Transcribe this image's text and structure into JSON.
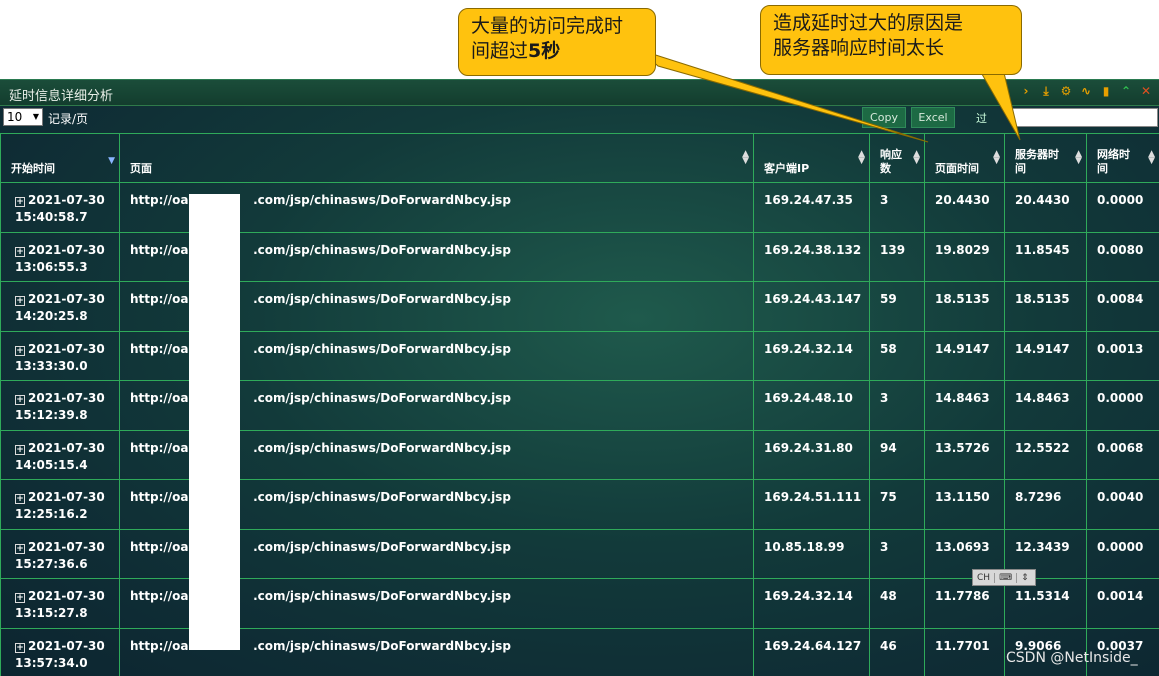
{
  "callouts": {
    "c1_line1": "大量的访问完成时",
    "c1_line2a": "间超过",
    "c1_line2b": "5秒",
    "c2_line1": "造成延时过大的原因是",
    "c2_line2": "服务器响应时间太长"
  },
  "panel": {
    "title": "延时信息详细分析",
    "icons": [
      "chevron-right-icon",
      "download-icon",
      "gear-icon",
      "line-chart-icon",
      "bar-chart-icon",
      "collapse-icon",
      "close-icon"
    ]
  },
  "toolbar": {
    "page_size": "10",
    "records_label": "记录/页",
    "copy_label": "Copy",
    "excel_label": "Excel",
    "search_label": "过"
  },
  "table": {
    "headers": [
      "开始时间",
      "页面",
      "客户端IP",
      "响应数",
      "页面时间",
      "服务器时间",
      "网络时间"
    ],
    "rows": [
      {
        "date": "2021-07-30",
        "time": "15:40:58.7",
        "page_prefix": "http://oa.",
        "page_suffix": ".com/jsp/chinasws/DoForwardNbcy.jsp",
        "ip": "169.24.47.35",
        "responses": "3",
        "page_time": "20.4430",
        "server_time": "20.4430",
        "network_time": "0.0000"
      },
      {
        "date": "2021-07-30",
        "time": "13:06:55.3",
        "page_prefix": "http://oa.",
        "page_suffix": ".com/jsp/chinasws/DoForwardNbcy.jsp",
        "ip": "169.24.38.132",
        "responses": "139",
        "page_time": "19.8029",
        "server_time": "11.8545",
        "network_time": "0.0080"
      },
      {
        "date": "2021-07-30",
        "time": "14:20:25.8",
        "page_prefix": "http://oa.",
        "page_suffix": ".com/jsp/chinasws/DoForwardNbcy.jsp",
        "ip": "169.24.43.147",
        "responses": "59",
        "page_time": "18.5135",
        "server_time": "18.5135",
        "network_time": "0.0084"
      },
      {
        "date": "2021-07-30",
        "time": "13:33:30.0",
        "page_prefix": "http://oa.",
        "page_suffix": ".com/jsp/chinasws/DoForwardNbcy.jsp",
        "ip": "169.24.32.14",
        "responses": "58",
        "page_time": "14.9147",
        "server_time": "14.9147",
        "network_time": "0.0013"
      },
      {
        "date": "2021-07-30",
        "time": "15:12:39.8",
        "page_prefix": "http://oa.",
        "page_suffix": ".com/jsp/chinasws/DoForwardNbcy.jsp",
        "ip": "169.24.48.10",
        "responses": "3",
        "page_time": "14.8463",
        "server_time": "14.8463",
        "network_time": "0.0000"
      },
      {
        "date": "2021-07-30",
        "time": "14:05:15.4",
        "page_prefix": "http://oa.",
        "page_suffix": ".com/jsp/chinasws/DoForwardNbcy.jsp",
        "ip": "169.24.31.80",
        "responses": "94",
        "page_time": "13.5726",
        "server_time": "12.5522",
        "network_time": "0.0068"
      },
      {
        "date": "2021-07-30",
        "time": "12:25:16.2",
        "page_prefix": "http://oa.",
        "page_suffix": ".com/jsp/chinasws/DoForwardNbcy.jsp",
        "ip": "169.24.51.111",
        "responses": "75",
        "page_time": "13.1150",
        "server_time": "8.7296",
        "network_time": "0.0040"
      },
      {
        "date": "2021-07-30",
        "time": "15:27:36.6",
        "page_prefix": "http://oa.",
        "page_suffix": ".com/jsp/chinasws/DoForwardNbcy.jsp",
        "ip": "10.85.18.99",
        "responses": "3",
        "page_time": "13.0693",
        "server_time": "12.3439",
        "network_time": "0.0000"
      },
      {
        "date": "2021-07-30",
        "time": "13:15:27.8",
        "page_prefix": "http://oa.",
        "page_suffix": ".com/jsp/chinasws/DoForwardNbcy.jsp",
        "ip": "169.24.32.14",
        "responses": "48",
        "page_time": "11.7786",
        "server_time": "11.5314",
        "network_time": "0.0014"
      },
      {
        "date": "2021-07-30",
        "time": "13:57:34.0",
        "page_prefix": "http://oa.",
        "page_suffix": ".com/jsp/chinasws/DoForwardNbcy.jsp",
        "ip": "169.24.64.127",
        "responses": "46",
        "page_time": "11.7701",
        "server_time": "9.9066",
        "network_time": "0.0037"
      }
    ]
  },
  "ime": {
    "label": "CH"
  },
  "watermark": "CSDN @NetInside_",
  "colors": {
    "accent_green": "#2faa5a",
    "callout_yellow": "#ffc20e",
    "icon_orange": "#e8a000"
  }
}
